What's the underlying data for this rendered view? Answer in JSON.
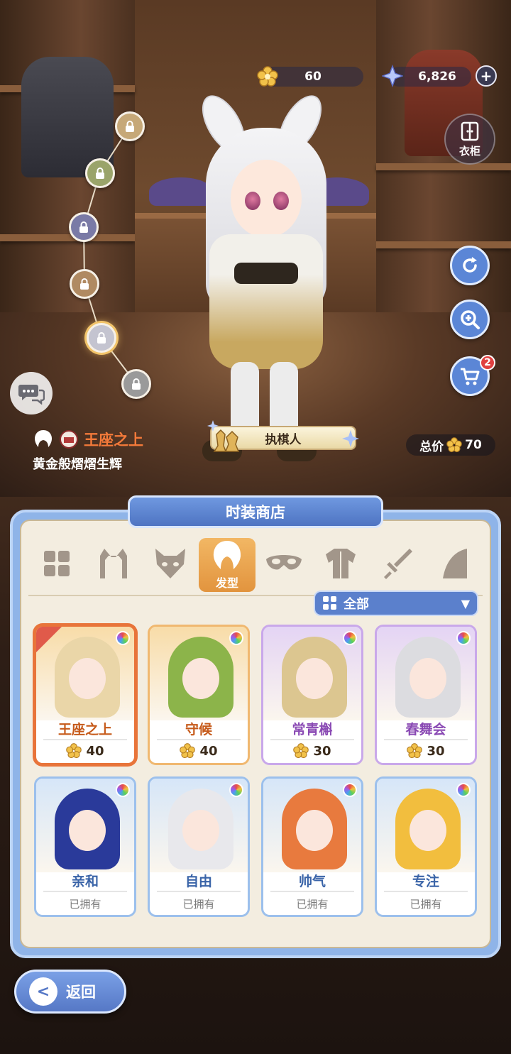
{
  "currencies": {
    "gold": {
      "value": "60",
      "icon": "gold-flower-icon"
    },
    "star": {
      "value": "6,826",
      "icon": "blue-star-icon"
    }
  },
  "side_buttons": {
    "wardrobe_label": "衣柜",
    "cart_badge": "2"
  },
  "outfit": {
    "name": "王座之上",
    "subtitle": "黄金般熠熠生辉",
    "tag": "执棋人",
    "total_label": "总价",
    "total_value": "70"
  },
  "shop": {
    "title": "时装商店",
    "tabs": [
      {
        "icon": "grid-icon",
        "label": ""
      },
      {
        "icon": "cat-ears-icon",
        "label": ""
      },
      {
        "icon": "fox-mask-icon",
        "label": ""
      },
      {
        "icon": "hair-icon",
        "label": "发型",
        "active": true
      },
      {
        "icon": "eye-mask-icon",
        "label": ""
      },
      {
        "icon": "coat-icon",
        "label": ""
      },
      {
        "icon": "sword-icon",
        "label": ""
      },
      {
        "icon": "cape-icon",
        "label": ""
      }
    ],
    "filter_label": "全部",
    "items": [
      {
        "name": "王座之上",
        "price": "40",
        "rarity": "orange",
        "hair_color": "#ead6a8",
        "selected": true
      },
      {
        "name": "守候",
        "price": "40",
        "rarity": "orange",
        "hair_color": "#8cb44a"
      },
      {
        "name": "常青槲",
        "price": "30",
        "rarity": "purple",
        "hair_color": "#dcc690"
      },
      {
        "name": "春舞会",
        "price": "30",
        "rarity": "purple",
        "hair_color": "#dcdce0"
      },
      {
        "name": "亲和",
        "owned": "已拥有",
        "rarity": "blue",
        "hair_color": "#2a3a9a"
      },
      {
        "name": "自由",
        "owned": "已拥有",
        "rarity": "blue",
        "hair_color": "#e8e8ec"
      },
      {
        "name": "帅气",
        "owned": "已拥有",
        "rarity": "blue",
        "hair_color": "#e87a3e"
      },
      {
        "name": "专注",
        "owned": "已拥有",
        "rarity": "blue",
        "hair_color": "#f2be3e"
      }
    ]
  },
  "back_label": "返回",
  "colors": {
    "orange_rarity_bg": "#f8dca8",
    "purple_rarity_bg": "#e4d4f4",
    "blue_rarity_bg": "#d6e6f8",
    "orange_name": "#c65a1a",
    "purple_name": "#8a4ab4",
    "blue_name": "#3a64a8"
  }
}
